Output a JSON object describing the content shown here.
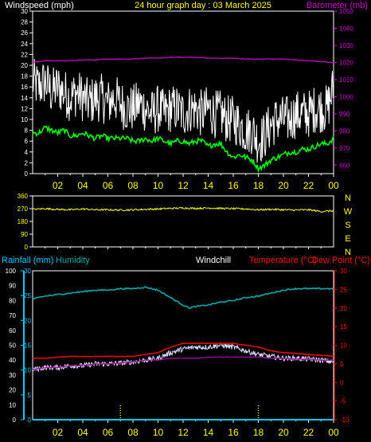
{
  "colors": {
    "background": "#000000",
    "axis": "#ffffff",
    "windspeed": "#ffffff",
    "wind_avg": "#00ff00",
    "barometer": "#cc00cc",
    "header_title": "#ffff00",
    "direction": "#ffff00",
    "rainfall": "#00ccff",
    "humidity": "#00aaaa",
    "windchill": "#ddddff",
    "temperature": "#ff0000",
    "dewpoint": "#aa00aa",
    "rain_tick": "#ffff00",
    "rain_bar": "#00ccff"
  },
  "chart_data": [
    {
      "type": "line",
      "title": "24 hour graph day : 03 March 2025",
      "left_axis_label": "Windspeed (mph)",
      "right_axis_label": "Barometer (mb)",
      "x_ticks": [
        "02",
        "04",
        "06",
        "08",
        "10",
        "12",
        "14",
        "16",
        "18",
        "20",
        "22",
        "00"
      ],
      "x_range": [
        0,
        24
      ],
      "y_left_range": [
        0,
        30
      ],
      "y_left_ticks": [
        "0",
        "2",
        "4",
        "6",
        "8",
        "10",
        "12",
        "14",
        "16",
        "18",
        "20",
        "22",
        "24",
        "26",
        "28",
        "30"
      ],
      "y_right_range": [
        955,
        1050
      ],
      "y_right_ticks": [
        "960",
        "970",
        "980",
        "990",
        "1000",
        "1010",
        "1020",
        "1030",
        "1040",
        "1050"
      ],
      "series": [
        {
          "key": "wind_gust",
          "axis": "left",
          "x": [
            0,
            0.5,
            1,
            1.5,
            2,
            2.5,
            3,
            3.5,
            4,
            4.5,
            5,
            5.5,
            6,
            6.5,
            7,
            7.5,
            8,
            8.5,
            9,
            9.5,
            10,
            10.5,
            11,
            11.5,
            12,
            12.5,
            13,
            13.5,
            14,
            14.5,
            15,
            15.5,
            16,
            16.5,
            17,
            17.5,
            18,
            18.5,
            19,
            19.5,
            20,
            20.5,
            21,
            21.5,
            22,
            22.5,
            23,
            23.5,
            24
          ],
          "y": [
            17,
            16,
            17,
            15,
            16,
            15,
            14,
            15,
            14,
            13,
            14,
            14,
            13,
            14,
            13,
            12,
            12,
            13,
            12,
            11,
            12,
            11,
            12,
            12,
            11,
            12,
            12,
            11,
            12,
            11,
            11,
            10,
            10,
            9,
            8,
            8,
            6,
            7,
            9,
            10,
            10,
            10,
            11,
            11,
            11,
            12,
            12,
            12,
            16
          ]
        },
        {
          "key": "wind_avg",
          "axis": "left",
          "x": [
            0,
            0.5,
            1,
            1.5,
            2,
            2.5,
            3,
            3.5,
            4,
            4.5,
            5,
            5.5,
            6,
            6.5,
            7,
            7.5,
            8,
            8.5,
            9,
            9.5,
            10,
            10.5,
            11,
            11.5,
            12,
            12.5,
            13,
            13.5,
            14,
            14.5,
            15,
            15.5,
            16,
            16.5,
            17,
            17.5,
            18,
            18.5,
            19,
            19.5,
            20,
            20.5,
            21,
            21.5,
            22,
            22.5,
            23,
            23.5,
            24
          ],
          "y": [
            7.5,
            7.5,
            8.5,
            8,
            7.5,
            8,
            7,
            7,
            7.5,
            7,
            6.5,
            7,
            6.5,
            6.5,
            6.5,
            6.5,
            6,
            6,
            6.5,
            6,
            6.5,
            6,
            5.5,
            6,
            6,
            5.5,
            6,
            6,
            5,
            5.5,
            5.5,
            4,
            3,
            3.5,
            3,
            2.5,
            1,
            1.5,
            2.5,
            3,
            3.5,
            4,
            4,
            4.5,
            4.5,
            5,
            5.5,
            5.5,
            6.5
          ]
        },
        {
          "key": "barometer",
          "axis": "right",
          "x": [
            0,
            1,
            2,
            3,
            4,
            5,
            6,
            7,
            8,
            9,
            10,
            11,
            12,
            13,
            14,
            15,
            16,
            17,
            18,
            19,
            20,
            21,
            22,
            23,
            24
          ],
          "y": [
            1020,
            1021,
            1021,
            1021,
            1021.5,
            1021.5,
            1022,
            1022,
            1022,
            1022.5,
            1022.5,
            1023,
            1023,
            1023,
            1022.5,
            1022.5,
            1022.5,
            1022,
            1022,
            1022,
            1022,
            1021.5,
            1021,
            1020.5,
            1020
          ]
        }
      ]
    },
    {
      "type": "line",
      "right_labels": [
        "N",
        "W",
        "S",
        "E",
        "N"
      ],
      "y_ticks": [
        "0",
        "90",
        "180",
        "270",
        "360"
      ],
      "y_range": [
        0,
        360
      ],
      "x_range": [
        0,
        24
      ],
      "series": [
        {
          "key": "direction",
          "x": [
            0,
            1,
            2,
            3,
            4,
            5,
            6,
            7,
            8,
            9,
            10,
            11,
            12,
            13,
            14,
            15,
            16,
            17,
            18,
            19,
            20,
            21,
            22,
            23,
            24
          ],
          "y": [
            265,
            270,
            265,
            262,
            268,
            262,
            262,
            260,
            262,
            265,
            268,
            272,
            275,
            272,
            275,
            272,
            270,
            268,
            262,
            265,
            262,
            260,
            262,
            250,
            255
          ]
        }
      ]
    },
    {
      "type": "line",
      "labels": {
        "rainfall": "Rainfall (mm)",
        "humidity": "Humidity",
        "windchill": "Windchill",
        "temperature": "Temperature (°C)",
        "dewpoint": "Dew Point (°C)"
      },
      "x_ticks": [
        "02",
        "04",
        "06",
        "08",
        "10",
        "12",
        "14",
        "16",
        "18",
        "20",
        "22",
        "00"
      ],
      "x_range": [
        0,
        24
      ],
      "humidity_range": [
        0,
        100
      ],
      "humidity_ticks": [
        "0",
        "10",
        "20",
        "30",
        "40",
        "50",
        "60",
        "70",
        "80",
        "90",
        "100"
      ],
      "rain_range": [
        0,
        30
      ],
      "rain_ticks": [
        "0",
        "5",
        "10",
        "15",
        "20",
        "25",
        "30"
      ],
      "temp_range": [
        -10,
        30
      ],
      "temp_ticks": [
        "-10",
        "-5",
        "0",
        "5",
        "10",
        "15",
        "20",
        "25",
        "30"
      ],
      "rain_tick_times": [
        7,
        18
      ],
      "series": [
        {
          "key": "humidity",
          "axis": "humidity",
          "x": [
            0,
            1,
            2,
            3,
            4,
            5,
            6,
            7,
            8,
            9,
            10,
            11,
            12,
            12.5,
            13,
            14,
            15,
            16,
            17,
            18,
            19,
            20,
            21,
            22,
            23,
            24
          ],
          "y": [
            81,
            83,
            84,
            85,
            86,
            87,
            87,
            88,
            88,
            89,
            87,
            82,
            77,
            75,
            76,
            77,
            79,
            80,
            82,
            83,
            85,
            87,
            88,
            88,
            88,
            88
          ]
        },
        {
          "key": "temperature",
          "axis": "temp",
          "x": [
            0,
            1,
            2,
            3,
            4,
            5,
            6,
            7,
            8,
            9,
            10,
            11,
            12,
            13,
            14,
            15,
            16,
            17,
            18,
            19,
            20,
            21,
            22,
            23,
            24
          ],
          "y": [
            6.5,
            6.5,
            6.8,
            7,
            7,
            7,
            7,
            7,
            7,
            7.5,
            8,
            9.5,
            10.5,
            10.5,
            10.5,
            10.5,
            10.5,
            10,
            9.5,
            8.5,
            8,
            7.8,
            7.5,
            7.3,
            7
          ]
        },
        {
          "key": "windchill",
          "axis": "temp",
          "x": [
            0,
            1,
            2,
            3,
            4,
            5,
            6,
            7,
            8,
            9,
            10,
            11,
            12,
            13,
            14,
            15,
            16,
            17,
            18,
            19,
            20,
            21,
            22,
            23,
            24
          ],
          "y": [
            3.5,
            4,
            4,
            4.5,
            4.5,
            5,
            5,
            5.2,
            5.5,
            6,
            6.5,
            8,
            9,
            9.5,
            9.5,
            10,
            9.5,
            8.5,
            7.5,
            7,
            6.5,
            6.5,
            6.3,
            6,
            5.5
          ]
        },
        {
          "key": "dewpoint",
          "axis": "temp",
          "x": [
            0,
            1,
            2,
            3,
            4,
            5,
            6,
            7,
            8,
            9,
            10,
            11,
            12,
            13,
            14,
            15,
            16,
            17,
            18,
            19,
            20,
            21,
            22,
            23,
            24
          ],
          "y": [
            3.5,
            4,
            4,
            4.5,
            4.5,
            5,
            5,
            5.2,
            5.5,
            6,
            6,
            6.5,
            6.5,
            6.5,
            6.8,
            6.8,
            6.8,
            6.8,
            6.8,
            6.5,
            6.5,
            6.3,
            6.2,
            6,
            6
          ]
        },
        {
          "key": "rainfall",
          "axis": "rain",
          "x": [
            0,
            24
          ],
          "y": [
            0,
            0
          ]
        }
      ]
    }
  ]
}
